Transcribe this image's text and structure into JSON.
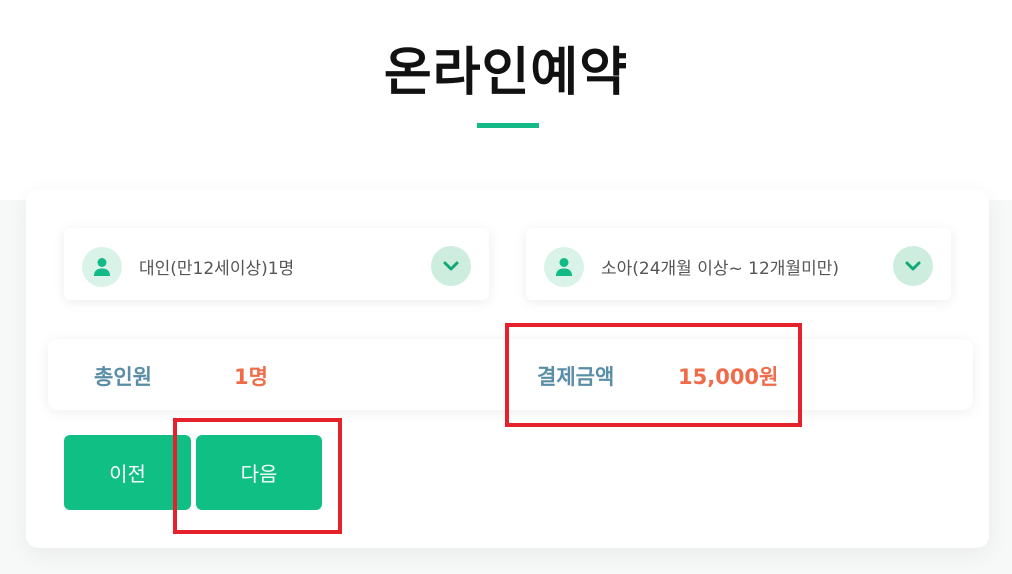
{
  "header": {
    "title": "온라인예약"
  },
  "selectors": {
    "adult": {
      "label": "대인(만12세이상)1명",
      "icon": "person-icon",
      "dropdown_icon": "chevron-down-icon"
    },
    "child": {
      "label": "소아(24개월 이상~ 12개월미만)",
      "icon": "person-icon",
      "dropdown_icon": "chevron-down-icon"
    }
  },
  "summary": {
    "total_people_label": "총인원",
    "total_people_value": "1명",
    "payment_label": "결제금액",
    "payment_value": "15,000원"
  },
  "buttons": {
    "prev_label": "이전",
    "next_label": "다음"
  },
  "colors": {
    "accent": "#10bf84",
    "label": "#5a8ea6",
    "value": "#ef6c4a",
    "highlight": "#e5222b"
  }
}
